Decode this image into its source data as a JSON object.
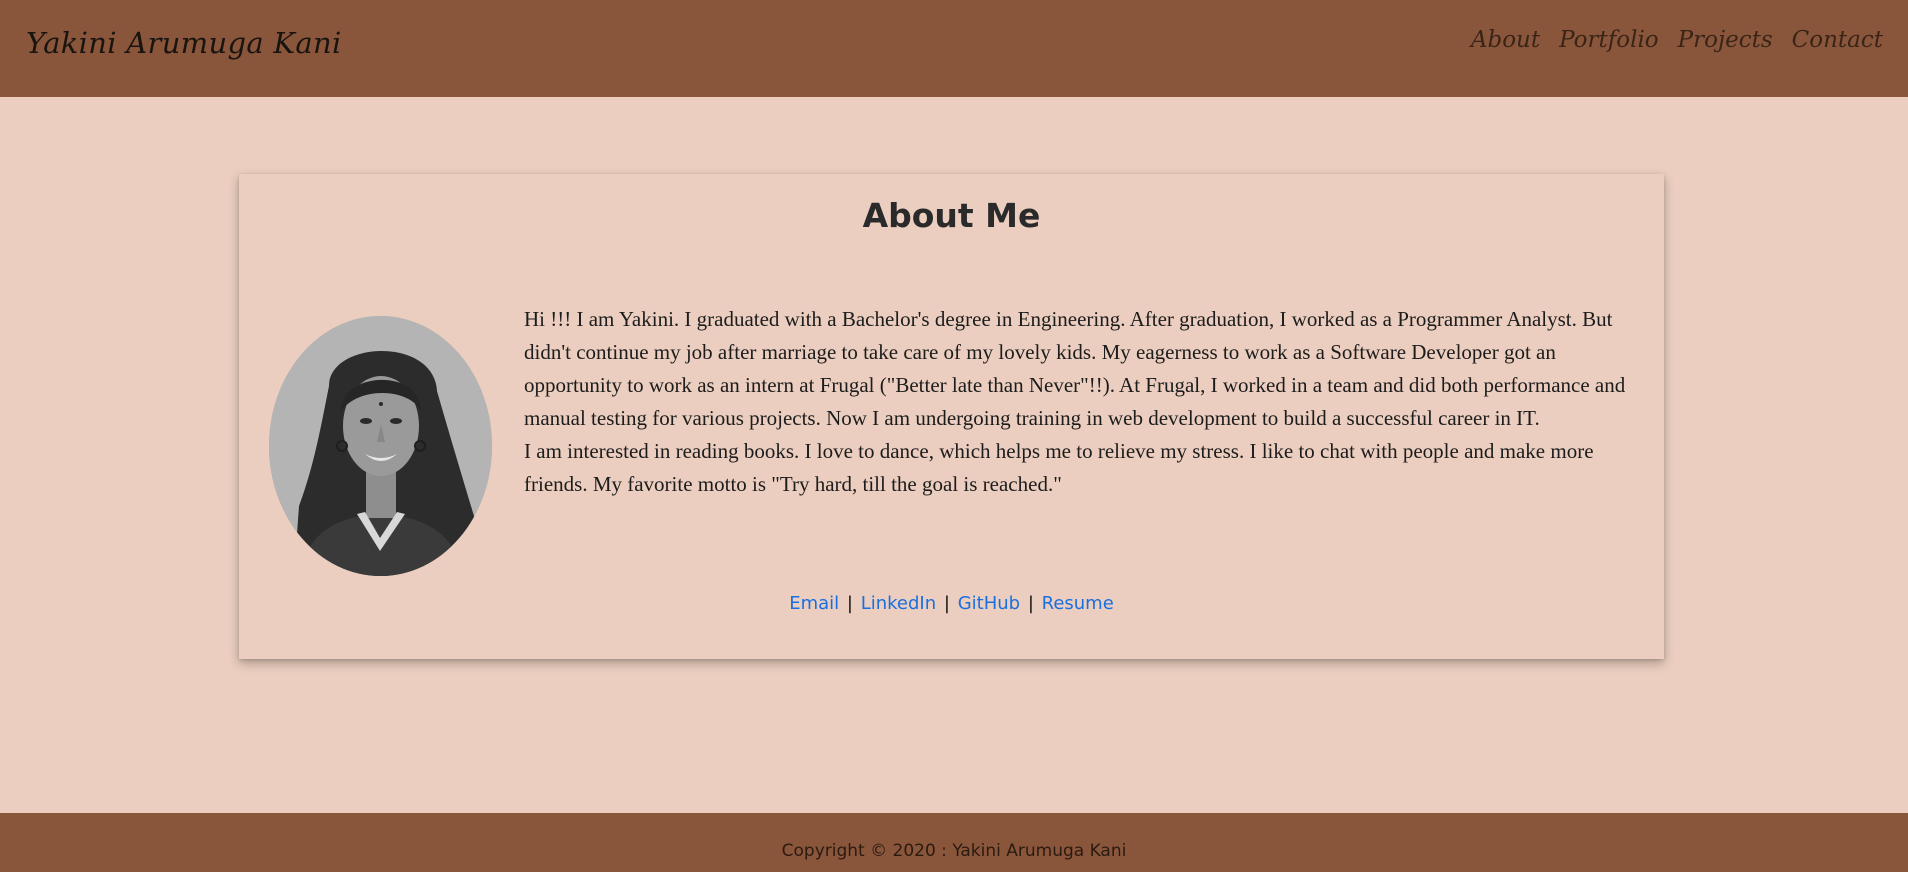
{
  "header": {
    "brand": "Yakini Arumuga Kani",
    "nav": [
      "About",
      "Portfolio",
      "Projects",
      "Contact"
    ]
  },
  "about": {
    "title": "About Me",
    "paragraph1": "Hi !!! I am Yakini. I graduated with a Bachelor's degree in Engineering. After graduation, I worked as a Programmer Analyst. But didn't continue my job after marriage to take care of my lovely kids. My eagerness to work as a Software Developer got an opportunity to work as an intern at Frugal (\"Better late than Never\"!!). At Frugal, I worked in a team and did both performance and manual testing for various projects. Now I am undergoing training in web development to build a successful career in IT.",
    "paragraph2": "I am interested in reading books. I love to dance, which helps me to relieve my stress. I like to chat with people and make more friends. My favorite motto is \"Try hard, till the goal is reached.\"",
    "links": [
      "Email",
      "LinkedIn",
      "GitHub",
      "Resume"
    ],
    "separator": "|"
  },
  "footer": {
    "copyright": "Copyright © 2020 : Yakini Arumuga Kani"
  },
  "colors": {
    "header_bg": "#8a563b",
    "page_bg": "#ebcebf",
    "link": "#1a6fe0"
  }
}
